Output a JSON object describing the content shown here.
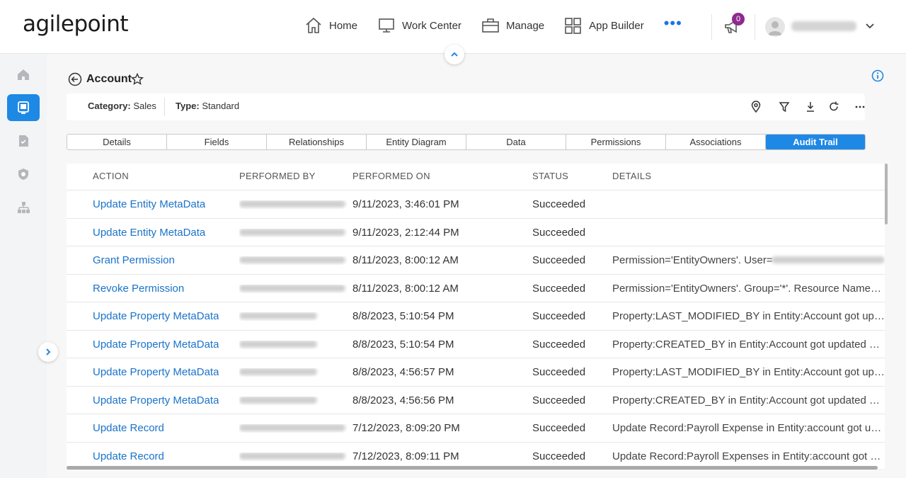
{
  "app": {
    "logo_text": "agilepoint"
  },
  "nav": {
    "items": [
      {
        "label": "Home",
        "icon": "home-icon"
      },
      {
        "label": "Work Center",
        "icon": "monitor-icon"
      },
      {
        "label": "Manage",
        "icon": "briefcase-icon"
      },
      {
        "label": "App Builder",
        "icon": "grid-icon"
      }
    ],
    "more_label": "•••",
    "notification_count": "0"
  },
  "sidebar": {
    "items": [
      {
        "icon": "home-icon",
        "active": false
      },
      {
        "icon": "work-center-icon",
        "active": true
      },
      {
        "icon": "tasks-icon",
        "active": false
      },
      {
        "icon": "shield-icon",
        "active": false
      },
      {
        "icon": "hierarchy-icon",
        "active": false
      }
    ]
  },
  "page": {
    "title": "Account",
    "category_label": "Category:",
    "category_value": "Sales",
    "type_label": "Type:",
    "type_value": "Standard"
  },
  "tabs": [
    {
      "label": "Details",
      "active": false
    },
    {
      "label": "Fields",
      "active": false
    },
    {
      "label": "Relationships",
      "active": false
    },
    {
      "label": "Entity Diagram",
      "active": false
    },
    {
      "label": "Data",
      "active": false
    },
    {
      "label": "Permissions",
      "active": false
    },
    {
      "label": "Associations",
      "active": false
    },
    {
      "label": "Audit Trail",
      "active": true
    }
  ],
  "table": {
    "headers": [
      "ACTION",
      "PERFORMED BY",
      "PERFORMED ON",
      "STATUS",
      "DETAILS"
    ],
    "rows": [
      {
        "action": "Update Entity MetaData",
        "performed_on": "9/11/2023, 3:46:01 PM",
        "status": "Succeeded",
        "details": ""
      },
      {
        "action": "Update Entity MetaData",
        "performed_on": "9/11/2023, 2:12:44 PM",
        "status": "Succeeded",
        "details": ""
      },
      {
        "action": "Grant Permission",
        "performed_on": "8/11/2023, 8:00:12 AM",
        "status": "Succeeded",
        "details": "Permission='EntityOwners'. User="
      },
      {
        "action": "Revoke Permission",
        "performed_on": "8/11/2023, 8:00:12 AM",
        "status": "Succeeded",
        "details": "Permission='EntityOwners'. Group='*'. Resource Name='A..."
      },
      {
        "action": "Update Property MetaData",
        "performed_on": "8/8/2023, 5:10:54 PM",
        "status": "Succeeded",
        "details": "Property:LAST_MODIFIED_BY in Entity:Account got updat..."
      },
      {
        "action": "Update Property MetaData",
        "performed_on": "8/8/2023, 5:10:54 PM",
        "status": "Succeeded",
        "details": "Property:CREATED_BY in Entity:Account got updated suc..."
      },
      {
        "action": "Update Property MetaData",
        "performed_on": "8/8/2023, 4:56:57 PM",
        "status": "Succeeded",
        "details": "Property:LAST_MODIFIED_BY in Entity:Account got updat..."
      },
      {
        "action": "Update Property MetaData",
        "performed_on": "8/8/2023, 4:56:56 PM",
        "status": "Succeeded",
        "details": "Property:CREATED_BY in Entity:Account got updated suc..."
      },
      {
        "action": "Update Record",
        "performed_on": "7/12/2023, 8:09:20 PM",
        "status": "Succeeded",
        "details": "Update Record:Payroll Expense in Entity:account got upd..."
      },
      {
        "action": "Update Record",
        "performed_on": "7/12/2023, 8:09:11 PM",
        "status": "Succeeded",
        "details": "Update Record:Payroll Expenses in Entity:account got upd"
      }
    ]
  },
  "colors": {
    "accent": "#1e88e5",
    "link": "#1a73c9",
    "badge": "#8e2a8e"
  }
}
